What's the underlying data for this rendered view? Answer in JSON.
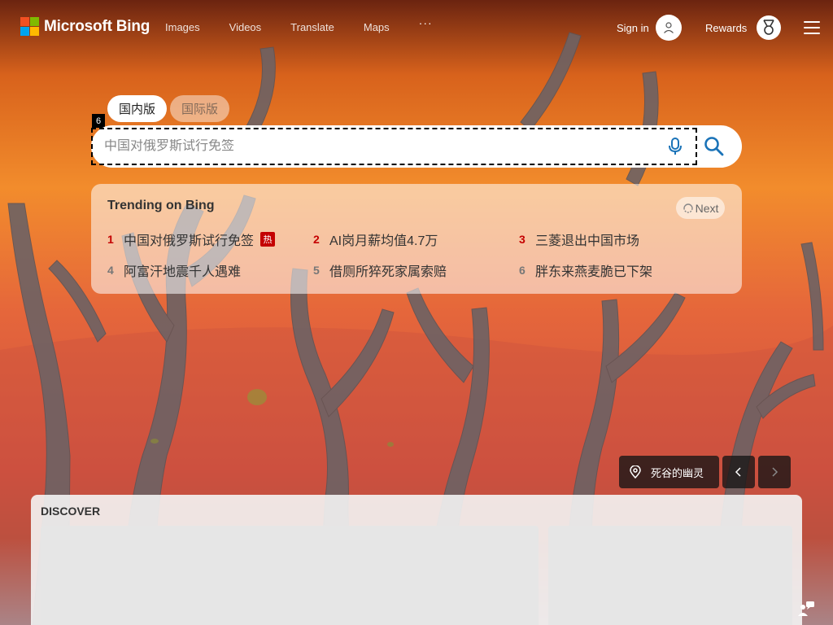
{
  "header": {
    "logo_text": "Microsoft Bing",
    "nav": [
      "Images",
      "Videos",
      "Translate",
      "Maps"
    ],
    "more_label": "···",
    "signin_label": "Sign in",
    "rewards_label": "Rewards"
  },
  "search": {
    "tabs": [
      {
        "label": "国内版",
        "active": true
      },
      {
        "label": "国际版",
        "active": false
      }
    ],
    "marker": "6",
    "placeholder": "中国对俄罗斯试行免签",
    "value": ""
  },
  "trending": {
    "title": "Trending on Bing",
    "next_label": "Next",
    "hot_label": "热",
    "items": [
      {
        "rank": "1",
        "text": "中国对俄罗斯试行免签",
        "hot": true,
        "rank_color": "#c40000"
      },
      {
        "rank": "2",
        "text": "AI岗月薪均值4.7万",
        "hot": false,
        "rank_color": "#c40000"
      },
      {
        "rank": "3",
        "text": "三菱退出中国市场",
        "hot": false,
        "rank_color": "#c40000"
      },
      {
        "rank": "4",
        "text": "阿富汗地震千人遇难",
        "hot": false,
        "rank_color": "#777777"
      },
      {
        "rank": "5",
        "text": "借厕所猝死家属索赔",
        "hot": false,
        "rank_color": "#777777"
      },
      {
        "rank": "6",
        "text": "胖东来燕麦脆已下架",
        "hot": false,
        "rank_color": "#777777"
      }
    ]
  },
  "image_info": {
    "location_label": "死谷的幽灵"
  },
  "discover": {
    "label": "DISCOVER"
  },
  "colors": {
    "accent": "#007daa",
    "hot_red": "#c40000",
    "ms_logo": [
      "#f25022",
      "#7fba00",
      "#00a4ef",
      "#ffb900"
    ]
  }
}
